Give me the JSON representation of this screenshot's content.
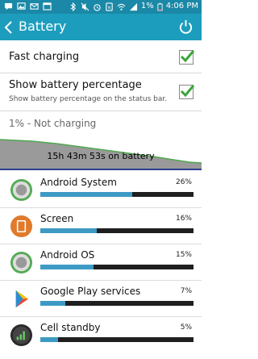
{
  "status_bar": {
    "battery_percent": "1%",
    "time": "4:06 PM"
  },
  "action_bar": {
    "title": "Battery"
  },
  "settings": {
    "fast_charging": {
      "label": "Fast charging",
      "checked": true
    },
    "show_percentage": {
      "label": "Show battery percentage",
      "description": "Show battery percentage on the status bar.",
      "checked": true
    }
  },
  "battery_status": "1% - Not charging",
  "graph": {
    "caption": "15h 43m 53s on battery"
  },
  "apps": [
    {
      "name": "Android System",
      "percent_label": "26%",
      "usage": 0.26,
      "icon": "android-system-icon"
    },
    {
      "name": "Screen",
      "percent_label": "16%",
      "usage": 0.16,
      "icon": "screen-icon"
    },
    {
      "name": "Android OS",
      "percent_label": "15%",
      "usage": 0.15,
      "icon": "android-os-icon"
    },
    {
      "name": "Google Play services",
      "percent_label": "7%",
      "usage": 0.07,
      "icon": "google-play-services-icon"
    },
    {
      "name": "Cell standby",
      "percent_label": "5%",
      "usage": 0.05,
      "icon": "cell-standby-icon"
    }
  ],
  "colors": {
    "action_bar": "#1d9dbd",
    "status_bar": "#1a88a6",
    "check": "#3aa53a",
    "usage_bar": "#3d9ac4"
  }
}
